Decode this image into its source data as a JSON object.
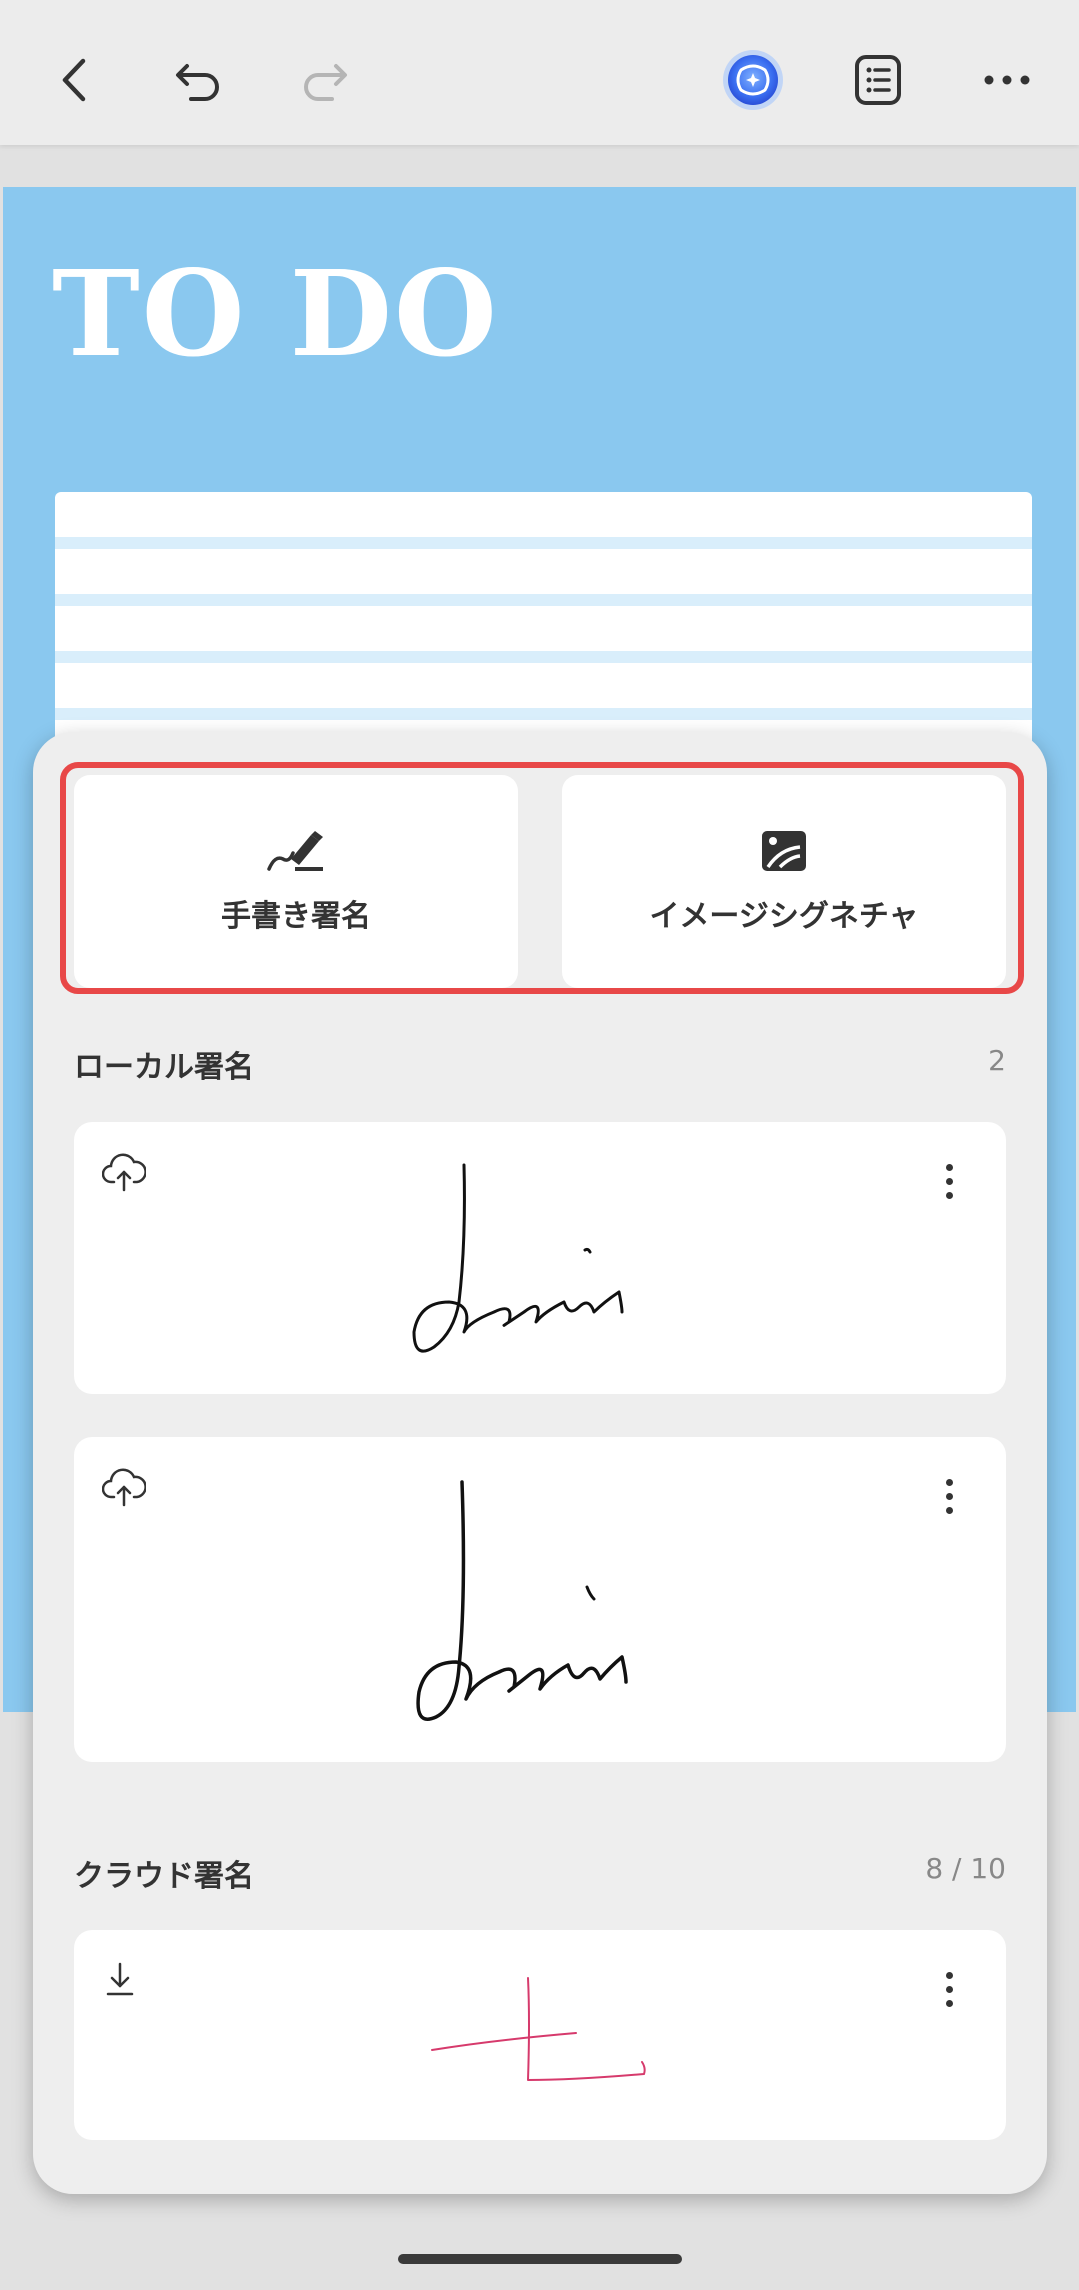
{
  "document": {
    "title": "TO DO"
  },
  "options": [
    {
      "label": "手書き署名",
      "icon": "handwriting-pen-icon"
    },
    {
      "label": "イメージシグネチャ",
      "icon": "image-icon"
    }
  ],
  "local": {
    "title": "ローカル署名",
    "count": "2",
    "items": [
      {
        "status_icon": "cloud-upload-icon"
      },
      {
        "status_icon": "cloud-upload-icon"
      }
    ]
  },
  "cloud": {
    "title": "クラウド署名",
    "count": "8 / 10",
    "items": [
      {
        "status_icon": "download-icon"
      }
    ]
  },
  "colors": {
    "accent_highlight": "#e84848",
    "doc_bg": "#8ac8ef",
    "cloud_signature_ink": "#d63a6c"
  }
}
